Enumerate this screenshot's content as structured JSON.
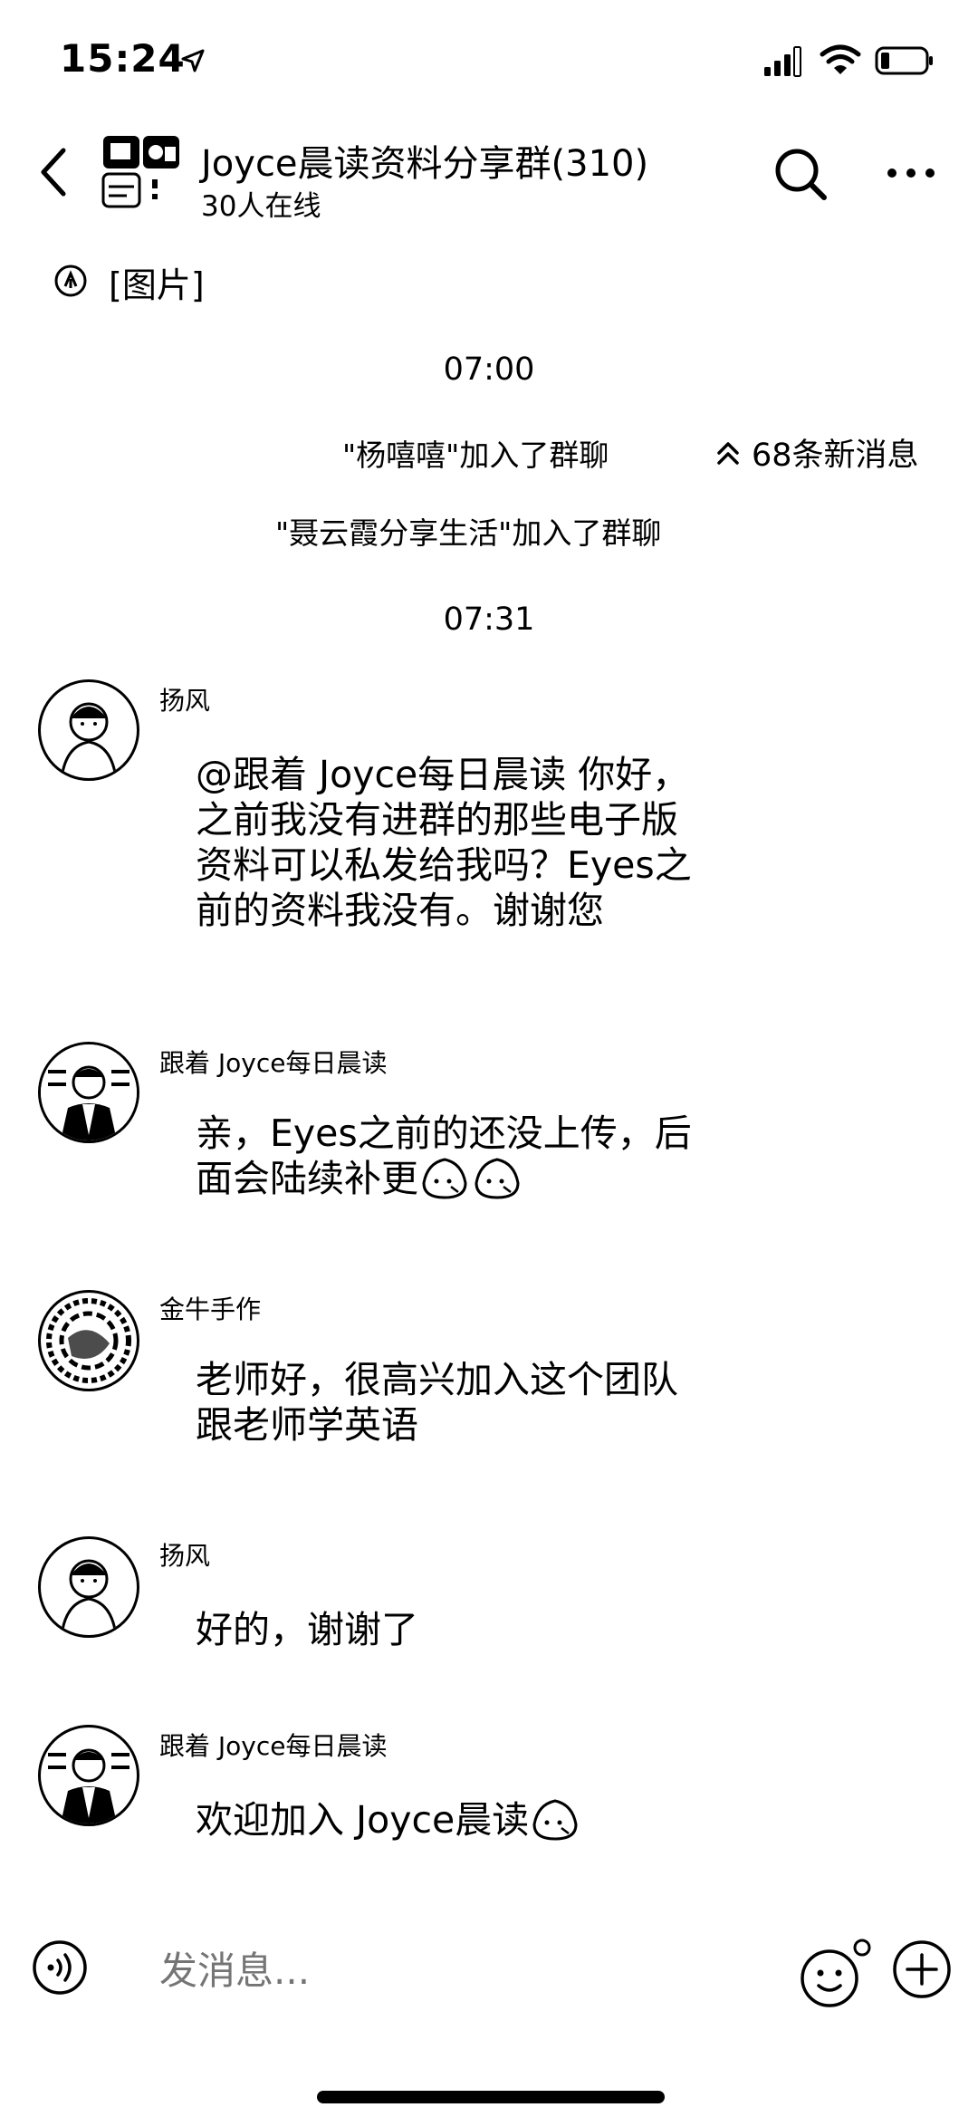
{
  "status_bar": {
    "time": "15:24"
  },
  "header": {
    "title": "Joyce晨读资料分享群(310)",
    "subtitle": "30人在线"
  },
  "pinned": {
    "text": "[图片]"
  },
  "timestamps": [
    "07:00",
    "07:31"
  ],
  "system_messages": [
    "\"杨嘻嘻\"加入了群聊",
    "\"聂云霞分享生活\"加入了群聊"
  ],
  "new_messages_label": "68条新消息",
  "messages": [
    {
      "sender": "扬风",
      "lines": [
        "@跟着 Joyce每日晨读 你好，",
        "之前我没有进群的那些电子版",
        "资料可以私发给我吗？Eyes之",
        "前的资料我没有。谢谢您"
      ]
    },
    {
      "sender": "跟着 Joyce每日晨读",
      "lines": [
        "亲，Eyes之前的还没上传，后",
        "面会陆续补更"
      ]
    },
    {
      "sender": "金牛手作",
      "lines": [
        "老师好，很高兴加入这个团队",
        "跟老师学英语"
      ]
    },
    {
      "sender": "扬风",
      "lines": [
        "好的，谢谢了"
      ]
    },
    {
      "sender": "跟着 Joyce每日晨读",
      "lines": [
        "欢迎加入 Joyce晨读"
      ]
    }
  ],
  "input": {
    "placeholder": "发消息..."
  },
  "icons": {
    "location": "location-arrow-icon",
    "back": "chevron-left-icon",
    "search": "search-icon",
    "more": "more-icon",
    "voice": "voice-icon",
    "emoji": "emoji-icon",
    "plus": "plus-icon",
    "sticker": "egg-face-emoji"
  }
}
